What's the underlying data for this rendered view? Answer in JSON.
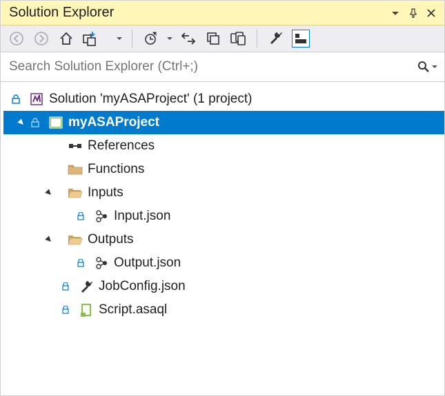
{
  "titlebar": {
    "title": "Solution Explorer"
  },
  "search": {
    "placeholder": "Search Solution Explorer (Ctrl+;)"
  },
  "tree": {
    "solution": "Solution 'myASAProject' (1 project)",
    "project": "myASAProject",
    "references": "References",
    "functions": "Functions",
    "inputs": "Inputs",
    "inputjson": "Input.json",
    "outputs": "Outputs",
    "outputjson": "Output.json",
    "jobconfig": "JobConfig.json",
    "script": "Script.asaql"
  }
}
